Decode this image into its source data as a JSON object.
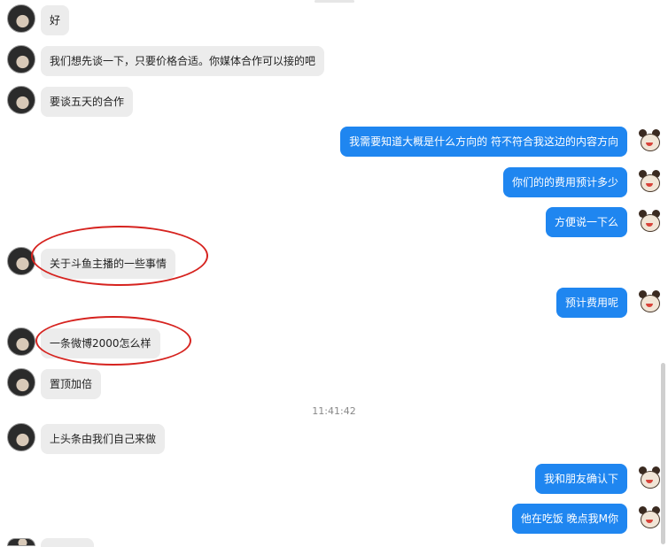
{
  "messages": {
    "m1": "好",
    "m2": "我们想先谈一下，只要价格合适。你媒体合作可以接的吧",
    "m3": "要谈五天的合作",
    "m4": "我需要知道大概是什么方向的 符不符合我这边的内容方向",
    "m5": "你们的的费用预计多少",
    "m6": "方便说一下么",
    "m7": "关于斗鱼主播的一些事情",
    "m8": "预计费用呢",
    "m9": "一条微博2000怎么样",
    "m10": "置顶加倍",
    "m11": "上头条由我们自己来做",
    "m12": "我和朋友确认下",
    "m13": "他在吃饭 晚点我M你"
  },
  "timestamp": "11:41:42",
  "colors": {
    "outgoing_bubble": "#1f86f0",
    "incoming_bubble": "#ececec",
    "highlight_ellipse": "#d6231f"
  }
}
